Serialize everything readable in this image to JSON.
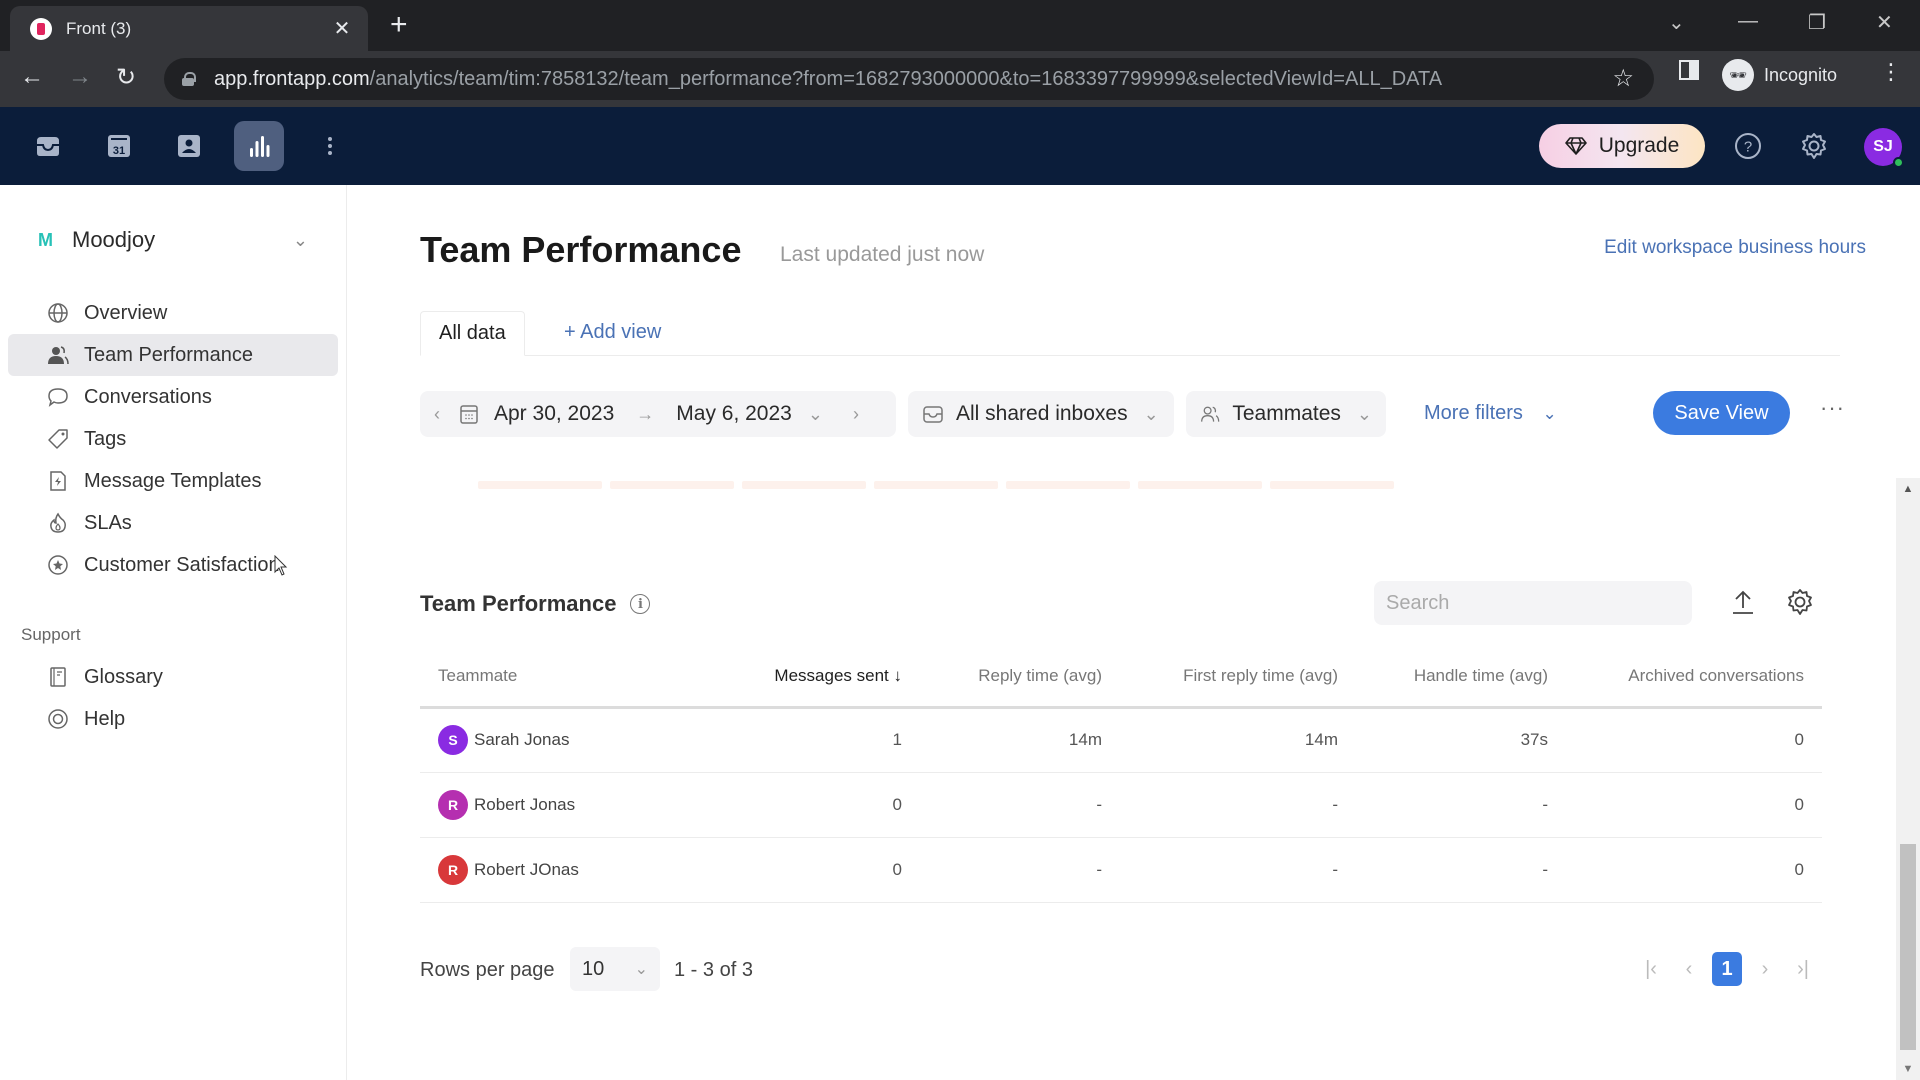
{
  "browser": {
    "tab_title": "Front (3)",
    "url_host": "app.frontapp.com",
    "url_path": "/analytics/team/tim:7858132/team_performance?from=1682793000000&to=1683397799999&selectedViewId=ALL_DATA",
    "profile_label": "Incognito"
  },
  "appbar": {
    "nav_icons": [
      "inbox-icon",
      "calendar-icon",
      "contacts-icon",
      "analytics-icon",
      "more-icon"
    ],
    "calendar_day": "31",
    "upgrade_label": "Upgrade",
    "user_initials": "SJ",
    "colors": {
      "bar_bg": "#0b1d3a",
      "avatar": "#8a2be2",
      "online": "#2fbf5b"
    }
  },
  "sidebar": {
    "workspace_initial": "M",
    "workspace_name": "Moodjoy",
    "items": [
      {
        "label": "Overview",
        "icon": "globe-icon"
      },
      {
        "label": "Team Performance",
        "icon": "users-icon",
        "active": true
      },
      {
        "label": "Conversations",
        "icon": "chat-bubble-icon"
      },
      {
        "label": "Tags",
        "icon": "tag-icon"
      },
      {
        "label": "Message Templates",
        "icon": "template-icon"
      },
      {
        "label": "SLAs",
        "icon": "fire-icon"
      },
      {
        "label": "Customer Satisfaction",
        "icon": "star-badge-icon"
      }
    ],
    "support_heading": "Support",
    "support_items": [
      {
        "label": "Glossary",
        "icon": "book-icon"
      },
      {
        "label": "Help",
        "icon": "lifebuoy-icon"
      }
    ]
  },
  "header": {
    "title": "Team Performance",
    "updated": "Last updated just now",
    "edit_hours": "Edit workspace business hours"
  },
  "views": {
    "tabs": [
      {
        "label": "All data",
        "active": true
      }
    ],
    "add_view": "+ Add view"
  },
  "filters": {
    "date_from": "Apr 30, 2023",
    "date_to": "May 6, 2023",
    "inboxes": "All shared inboxes",
    "teammates": "Teammates",
    "more_filters": "More filters",
    "save_view": "Save View",
    "more_options": "···"
  },
  "table_section": {
    "title": "Team Performance",
    "search_placeholder": "Search",
    "search_value": "",
    "columns": [
      "Teammate",
      "Messages sent",
      "Reply time (avg)",
      "First reply time (avg)",
      "Handle time (avg)",
      "Archived conversations"
    ],
    "sorted_column": "Messages sent",
    "sort_direction": "descending",
    "rows": [
      {
        "initial": "S",
        "color": "#8a2be2",
        "name": "Sarah Jonas",
        "messages_sent": "1",
        "reply_time": "14m",
        "first_reply_time": "14m",
        "handle_time": "37s",
        "archived": "0"
      },
      {
        "initial": "R",
        "color": "#b52fb0",
        "name": "Robert Jonas",
        "messages_sent": "0",
        "reply_time": "-",
        "first_reply_time": "-",
        "handle_time": "-",
        "archived": "0"
      },
      {
        "initial": "R",
        "color": "#d8383a",
        "name": "Robert JOnas",
        "messages_sent": "0",
        "reply_time": "-",
        "first_reply_time": "-",
        "handle_time": "-",
        "archived": "0"
      }
    ]
  },
  "pagination": {
    "rows_per_page_label": "Rows per page",
    "rows_per_page": "10",
    "range": "1 - 3 of 3",
    "current_page": "1"
  },
  "colors": {
    "accent": "#3b7be0",
    "link": "#4a72b5"
  }
}
